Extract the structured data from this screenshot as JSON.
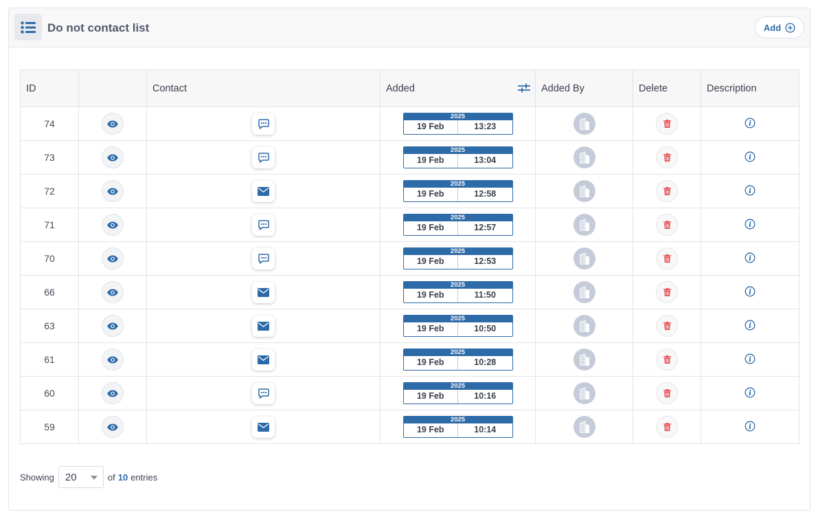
{
  "header": {
    "title": "Do not contact list",
    "add_label": "Add"
  },
  "table": {
    "columns": [
      "ID",
      "",
      "Contact",
      "Added",
      "Added By",
      "Delete",
      "Description"
    ],
    "rows": [
      {
        "id": "74",
        "contact_type": "chat-icon",
        "year": "2025",
        "date": "19 Feb",
        "time": "13:23"
      },
      {
        "id": "73",
        "contact_type": "chat-icon",
        "year": "2025",
        "date": "19 Feb",
        "time": "13:04"
      },
      {
        "id": "72",
        "contact_type": "envelope-icon",
        "year": "2025",
        "date": "19 Feb",
        "time": "12:58"
      },
      {
        "id": "71",
        "contact_type": "chat-icon",
        "year": "2025",
        "date": "19 Feb",
        "time": "12:57"
      },
      {
        "id": "70",
        "contact_type": "chat-icon",
        "year": "2025",
        "date": "19 Feb",
        "time": "12:53"
      },
      {
        "id": "66",
        "contact_type": "envelope-icon",
        "year": "2025",
        "date": "19 Feb",
        "time": "11:50"
      },
      {
        "id": "63",
        "contact_type": "envelope-icon",
        "year": "2025",
        "date": "19 Feb",
        "time": "10:50"
      },
      {
        "id": "61",
        "contact_type": "envelope-icon",
        "year": "2025",
        "date": "19 Feb",
        "time": "10:28"
      },
      {
        "id": "60",
        "contact_type": "chat-icon",
        "year": "2025",
        "date": "19 Feb",
        "time": "10:16"
      },
      {
        "id": "59",
        "contact_type": "envelope-icon",
        "year": "2025",
        "date": "19 Feb",
        "time": "10:14"
      }
    ]
  },
  "footer": {
    "showing_label": "Showing",
    "page_size": "20",
    "of_label": "of",
    "total": "10",
    "entries_label": "entries"
  },
  "colors": {
    "accent": "#2d6aa8",
    "delete": "#e5484d",
    "avatar": "#c5cbd8"
  }
}
